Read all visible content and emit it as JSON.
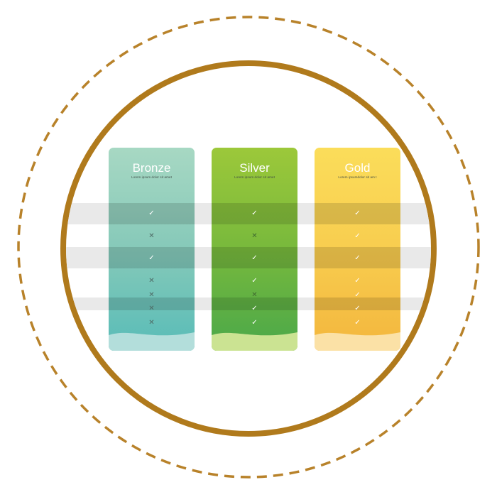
{
  "colors": {
    "ring": "#b07a1c",
    "dashed_ring": "#b8822a",
    "bronze": "#6ec4b9",
    "silver": "#7ab83c",
    "gold": "#f6c445",
    "stripe": "#e9e9e9"
  },
  "plans": [
    {
      "name": "Bronze",
      "subtitle": "Lorem ipsum dolor sit amet",
      "features": [
        "check",
        "cross",
        "check",
        "cross",
        "cross",
        "cross",
        "cross"
      ]
    },
    {
      "name": "Silver",
      "subtitle": "Lorem ipsum dolor sit amet",
      "features": [
        "check",
        "cross",
        "check",
        "check",
        "cross",
        "check",
        "check"
      ]
    },
    {
      "name": "Gold",
      "subtitle": "Lorem ipsumdolor sit am t",
      "features": [
        "check",
        "check",
        "check",
        "check",
        "check",
        "check",
        "check"
      ]
    }
  ]
}
